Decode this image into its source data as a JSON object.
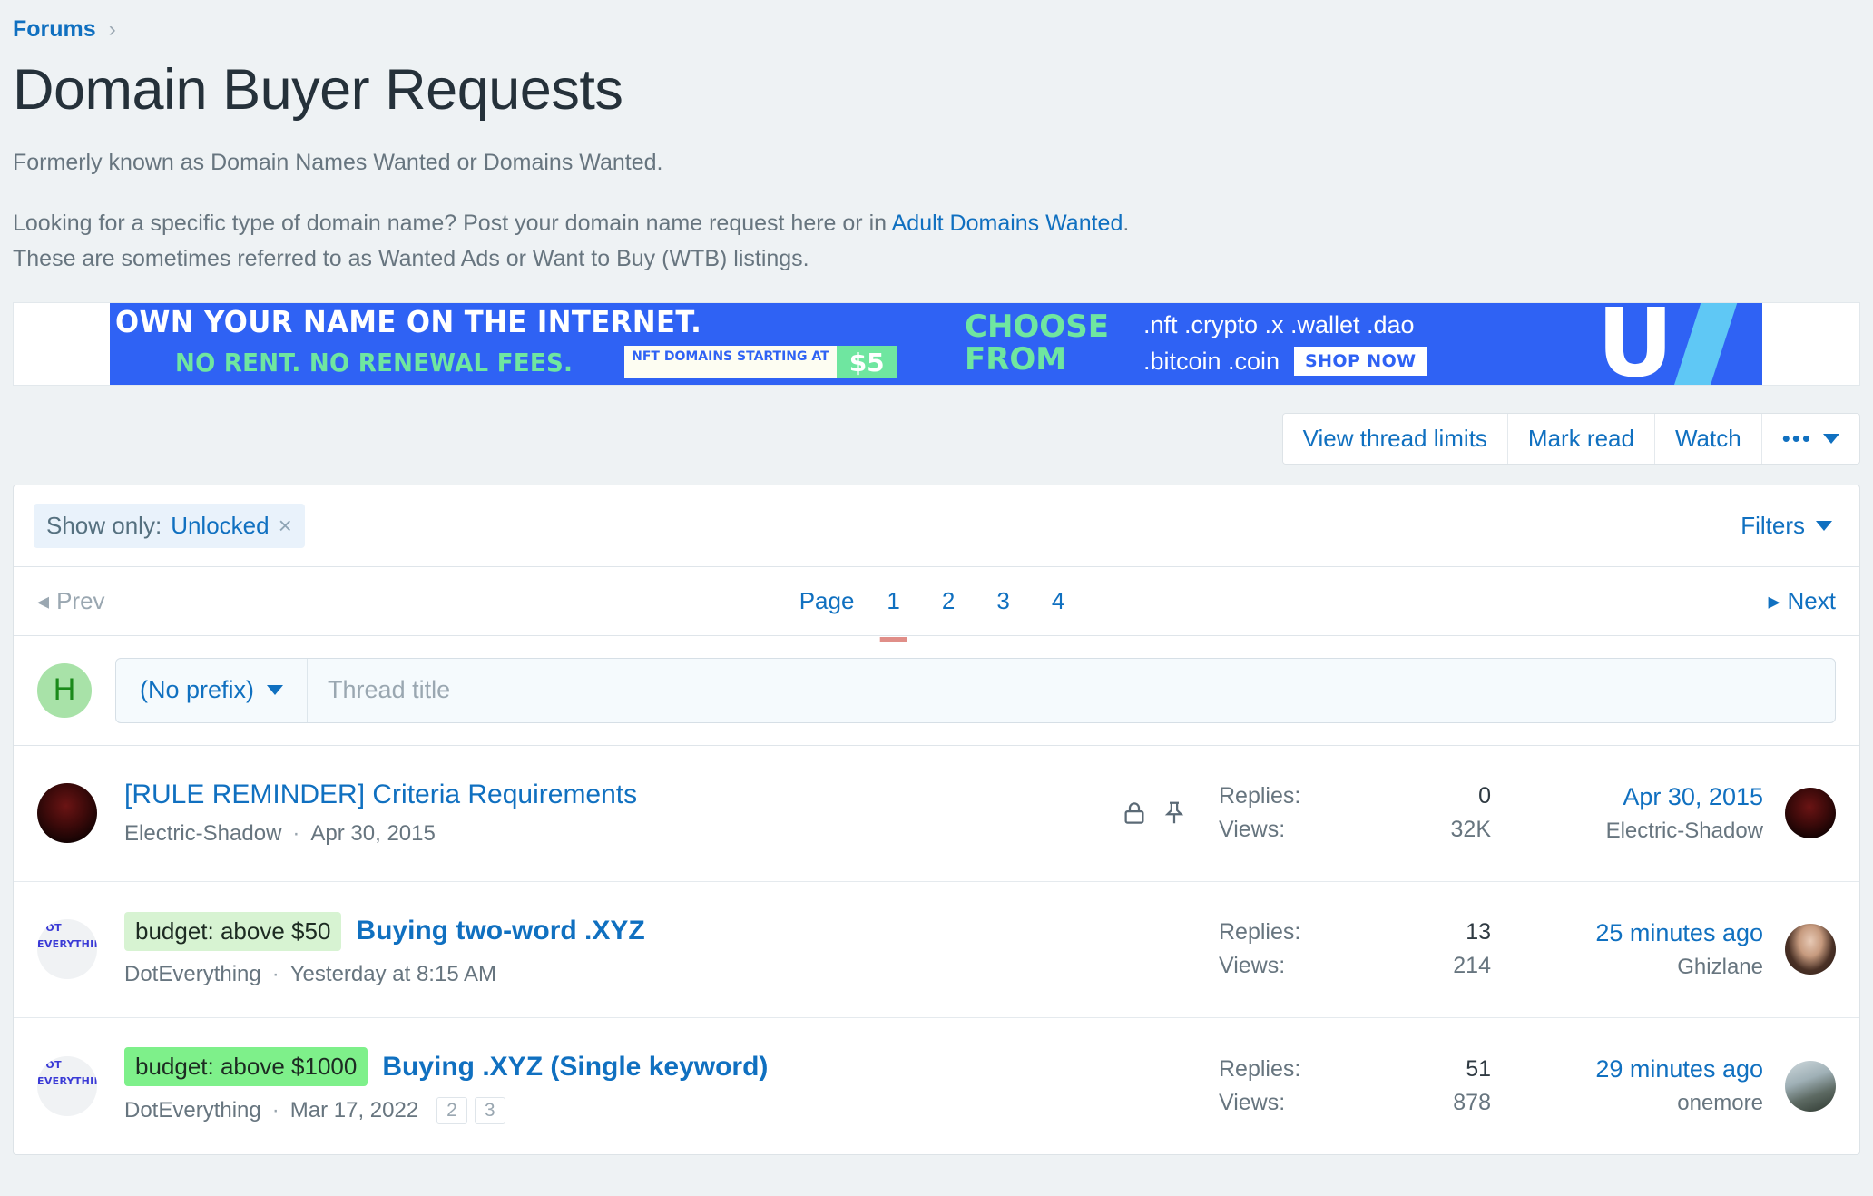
{
  "breadcrumb": {
    "root": "Forums",
    "separator": "›"
  },
  "page": {
    "title": "Domain Buyer Requests",
    "subtitle": "Formerly known as Domain Names Wanted or Domains Wanted.",
    "desc_part1": "Looking for a specific type of domain name? Post your domain name request here or in ",
    "desc_link": "Adult Domains Wanted",
    "desc_part2": ".",
    "desc_line2": "These are sometimes referred to as Wanted Ads or Want to Buy (WTB) listings."
  },
  "ad": {
    "headline": "OWN YOUR NAME ON THE INTERNET.",
    "subline": "NO RENT. NO RENEWAL FEES.",
    "nft_label": "NFT DOMAINS STARTING AT",
    "price": "$5",
    "choose_line1": "CHOOSE",
    "choose_line2": "FROM",
    "tlds_line1": ".nft  .crypto  .x .wallet .dao",
    "tlds_line2": ".bitcoin  .coin",
    "shop_now": "SHOP NOW",
    "logo_letter": "U",
    "bg_color": "#2f62f4",
    "accent_color": "#6fe6a0"
  },
  "toolbar": {
    "view_thread_limits": "View thread limits",
    "mark_read": "Mark read",
    "watch": "Watch",
    "more_dots": "•••"
  },
  "filterbar": {
    "chip_label": "Show only:",
    "chip_value": "Unlocked",
    "chip_remove": "×",
    "filters_label": "Filters"
  },
  "pagination": {
    "prev": "Prev",
    "next": "Next",
    "page_label": "Page",
    "pages": [
      "1",
      "2",
      "3",
      "4"
    ],
    "active_page": "1",
    "active_underline_color": "#e08e88"
  },
  "new_thread": {
    "avatar_initial": "H",
    "prefix_label": "(No prefix)",
    "title_placeholder": "Thread title"
  },
  "threads": [
    {
      "avatar": "dark-red-portrait",
      "prefix": null,
      "prefix_style": null,
      "title": "[RULE REMINDER] Criteria Requirements",
      "title_weight": "normal",
      "author": "Electric-Shadow",
      "date": "Apr 30, 2015",
      "page_chips": [],
      "icons": [
        "lock-icon",
        "pin-icon"
      ],
      "replies_label": "Replies:",
      "replies_value": "0",
      "views_label": "Views:",
      "views_value": "32K",
      "last_date": "Apr 30, 2015",
      "last_user": "Electric-Shadow",
      "last_avatar": "dark-red-portrait"
    },
    {
      "avatar": "doteverything-logo",
      "prefix": "budget: above $50",
      "prefix_style": "light",
      "title": "Buying two-word .XYZ",
      "title_weight": "bold",
      "author": "DotEverything",
      "date": "Yesterday at 8:15 AM",
      "page_chips": [],
      "icons": [],
      "replies_label": "Replies:",
      "replies_value": "13",
      "views_label": "Views:",
      "views_value": "214",
      "last_date": "25 minutes ago",
      "last_user": "Ghizlane",
      "last_avatar": "woman-portrait"
    },
    {
      "avatar": "doteverything-logo",
      "prefix": "budget: above $1000",
      "prefix_style": "bright",
      "title": "Buying .XYZ (Single keyword)",
      "title_weight": "bold",
      "author": "DotEverything",
      "date": "Mar 17, 2022",
      "page_chips": [
        "2",
        "3"
      ],
      "icons": [],
      "replies_label": "Replies:",
      "replies_value": "51",
      "views_label": "Views:",
      "views_value": "878",
      "last_date": "29 minutes ago",
      "last_user": "onemore",
      "last_avatar": "beach-photo"
    }
  ],
  "avatar_text": {
    "dot": "DOT",
    "everything": "EVERYTHING"
  }
}
